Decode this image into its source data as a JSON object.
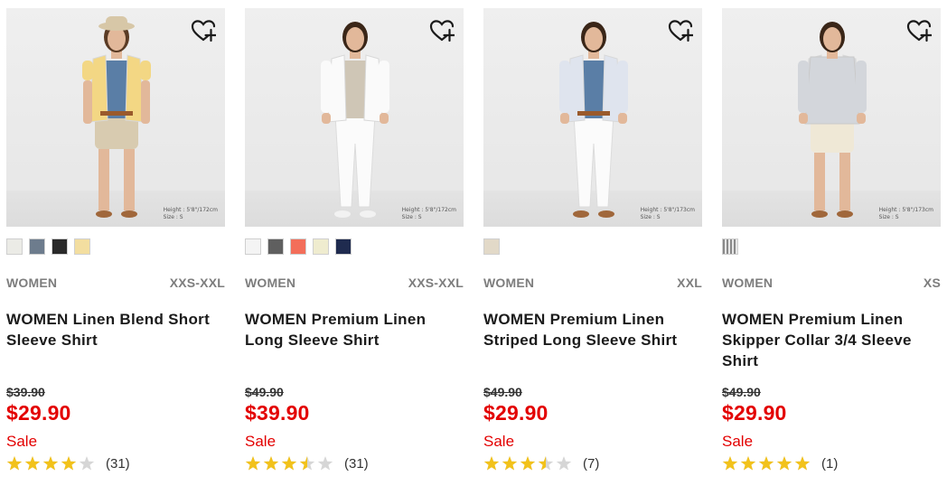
{
  "products": [
    {
      "model_note": [
        "Height : 5'8\"/172cm",
        "Size : S"
      ],
      "swatches": [
        "#ebebe6",
        "#6d7c8d",
        "#2a2a2a",
        "#f3dea0"
      ],
      "gender": "WOMEN",
      "size_range": "XXS-XXL",
      "name": "WOMEN Linen Blend Short Sleeve Shirt",
      "original_price": "$39.90",
      "price": "$29.90",
      "flag": "Sale",
      "rating": 4,
      "review_count": "(31)",
      "colors": {
        "top": "#f3d784",
        "inner": "#5a7ea6",
        "bottom": "#d8cbb0",
        "hat": "#d7c7a7"
      }
    },
    {
      "model_note": [
        "Height : 5'8\"/172cm",
        "Size : S"
      ],
      "swatches": [
        "#f4f4f4",
        "#5f5f5f",
        "#f36e5a",
        "#efeccf",
        "#1f2b4f"
      ],
      "gender": "WOMEN",
      "size_range": "XXS-XXL",
      "name": "WOMEN Premium Linen Long Sleeve Shirt",
      "original_price": "$49.90",
      "price": "$39.90",
      "flag": "Sale",
      "rating": 3.5,
      "review_count": "(31)",
      "colors": {
        "top": "#fafafa",
        "inner": "#cfc6b6",
        "bottom": "#fbfbfb",
        "hat": ""
      }
    },
    {
      "model_note": [
        "Height : 5'8\"/173cm",
        "Size : S"
      ],
      "swatches": [
        "#e2d9c8"
      ],
      "gender": "WOMEN",
      "size_range": "XXL",
      "name": "WOMEN Premium Linen Striped Long Sleeve Shirt",
      "original_price": "$49.90",
      "price": "$29.90",
      "flag": "Sale",
      "rating": 3.5,
      "review_count": "(7)",
      "colors": {
        "top": "#dfe4ee",
        "inner": "#5a7ea6",
        "bottom": "#fbfbfb",
        "hat": ""
      }
    },
    {
      "model_note": [
        "Height : 5'8\"/173cm",
        "Size : S"
      ],
      "swatches": [
        "stripe"
      ],
      "gender": "WOMEN",
      "size_range": "XS",
      "name": "WOMEN Premium Linen Skipper Collar 3/4 Sleeve Shirt",
      "original_price": "$49.90",
      "price": "$29.90",
      "flag": "Sale",
      "rating": 5,
      "review_count": "(1)",
      "colors": {
        "top": "#d3d6db",
        "inner": "#d3d6db",
        "bottom": "#efe8d6",
        "hat": ""
      }
    }
  ],
  "theme": {
    "star_filled": "#f2c21b",
    "star_empty": "#d6d6d6",
    "sale_red": "#e30000"
  },
  "icons": {
    "wishlist": "heart-plus-icon",
    "rating": "star-icon"
  }
}
